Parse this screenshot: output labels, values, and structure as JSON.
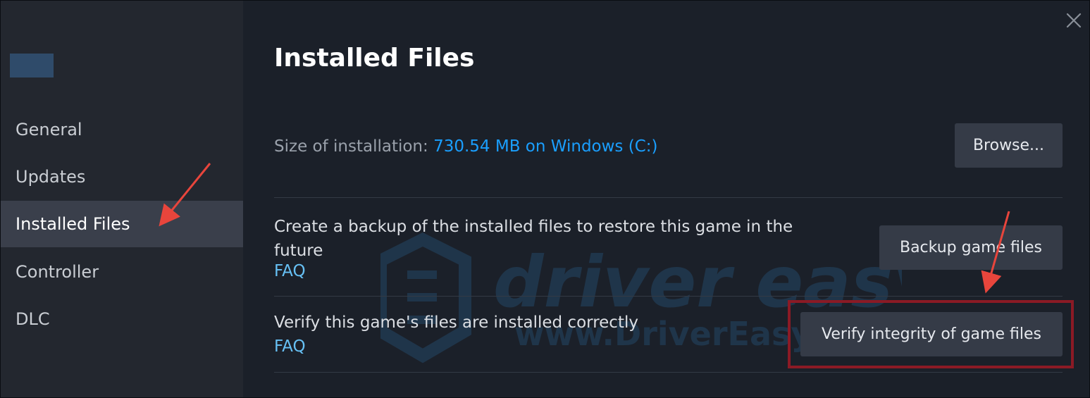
{
  "sidebar": {
    "items": [
      {
        "label": "General",
        "active": false
      },
      {
        "label": "Updates",
        "active": false
      },
      {
        "label": "Installed Files",
        "active": true
      },
      {
        "label": "Controller",
        "active": false
      },
      {
        "label": "DLC",
        "active": false
      }
    ]
  },
  "main": {
    "title": "Installed Files",
    "size_row": {
      "label": "Size of installation:",
      "value": "730.54 MB on Windows (C:)",
      "button_label": "Browse..."
    },
    "backup_row": {
      "description": "Create a backup of the installed files to restore this game in the future",
      "link": "FAQ",
      "button_label": "Backup game files"
    },
    "verify_row": {
      "description": "Verify this game's files are installed correctly",
      "link": "FAQ",
      "button_label": "Verify integrity of game files"
    }
  },
  "watermark": {
    "brand": "driver easy",
    "url": "www.DriverEasy.com"
  },
  "colors": {
    "accent_link": "#67c1f5",
    "size_value": "#1a9fff",
    "highlight_box": "#8b1a25",
    "annotation_arrow": "#e8453c"
  },
  "icons": {
    "close": "close-icon",
    "watermark_logo": "drivereasy-logo-icon"
  }
}
